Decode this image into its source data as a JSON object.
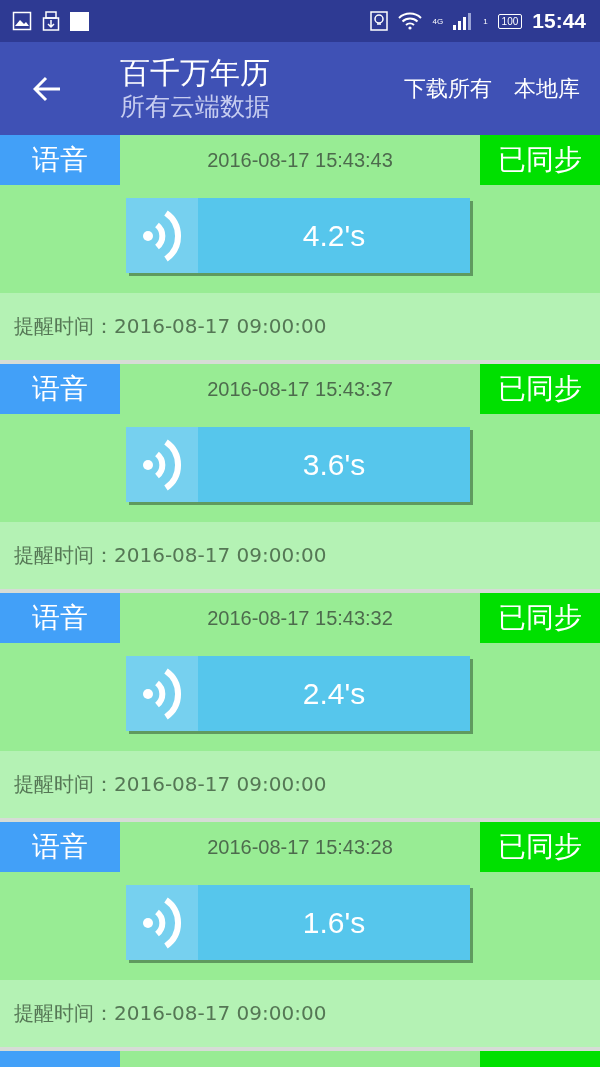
{
  "status_bar": {
    "network": "4G",
    "sim": "1",
    "battery": "100",
    "time": "15:44"
  },
  "app_bar": {
    "title": "百千万年历",
    "subtitle": "所有云端数据",
    "actions": [
      "下载所有",
      "本地库"
    ]
  },
  "records": [
    {
      "type_tag": "语音",
      "timestamp": "2016-08-17 15:43:43",
      "sync_status": "已同步",
      "duration": "4.2's",
      "reminder": "提醒时间：2016-08-17 09:00:00"
    },
    {
      "type_tag": "语音",
      "timestamp": "2016-08-17 15:43:37",
      "sync_status": "已同步",
      "duration": "3.6's",
      "reminder": "提醒时间：2016-08-17 09:00:00"
    },
    {
      "type_tag": "语音",
      "timestamp": "2016-08-17 15:43:32",
      "sync_status": "已同步",
      "duration": "2.4's",
      "reminder": "提醒时间：2016-08-17 09:00:00"
    },
    {
      "type_tag": "语音",
      "timestamp": "2016-08-17 15:43:28",
      "sync_status": "已同步",
      "duration": "1.6's",
      "reminder": "提醒时间：2016-08-17 09:00:00"
    }
  ]
}
